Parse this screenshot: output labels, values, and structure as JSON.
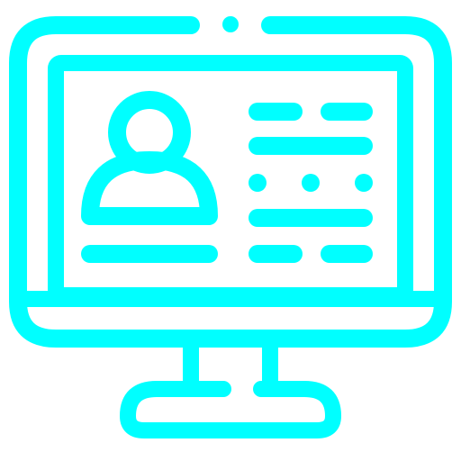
{
  "icon": {
    "name": "computer-monitor-user-profile-icon",
    "style": "outline",
    "stroke_color": "#00FFFF",
    "background": "#FFFFFF"
  }
}
